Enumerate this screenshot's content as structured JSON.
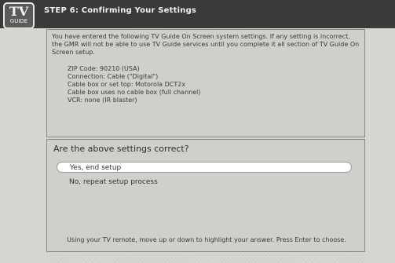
{
  "header": {
    "logo_text": "TV",
    "logo_subtext": "GUIDE",
    "title": "STEP 6: Confirming Your Settings"
  },
  "summary": {
    "intro": "You have entered the following TV Guide On Screen system settings. If any setting is incorrect, the GMR will not be able to use TV Guide services until you complete it all section of TV Guide On Screen setup.",
    "settings": [
      "ZIP Code:  90210 (USA)",
      "Connection: Cable (\"Digital\")",
      "Cable box or set top: Motorola DCT2x",
      "Cable box uses no cable box (full channel)",
      "VCR:  none (IR blaster)"
    ]
  },
  "confirm": {
    "question": "Are the above settings correct?",
    "options": [
      "Yes, end setup",
      "No, repeat setup process"
    ],
    "instructions": "Using your TV remote, move up or down to highlight your answer. Press Enter to choose."
  }
}
